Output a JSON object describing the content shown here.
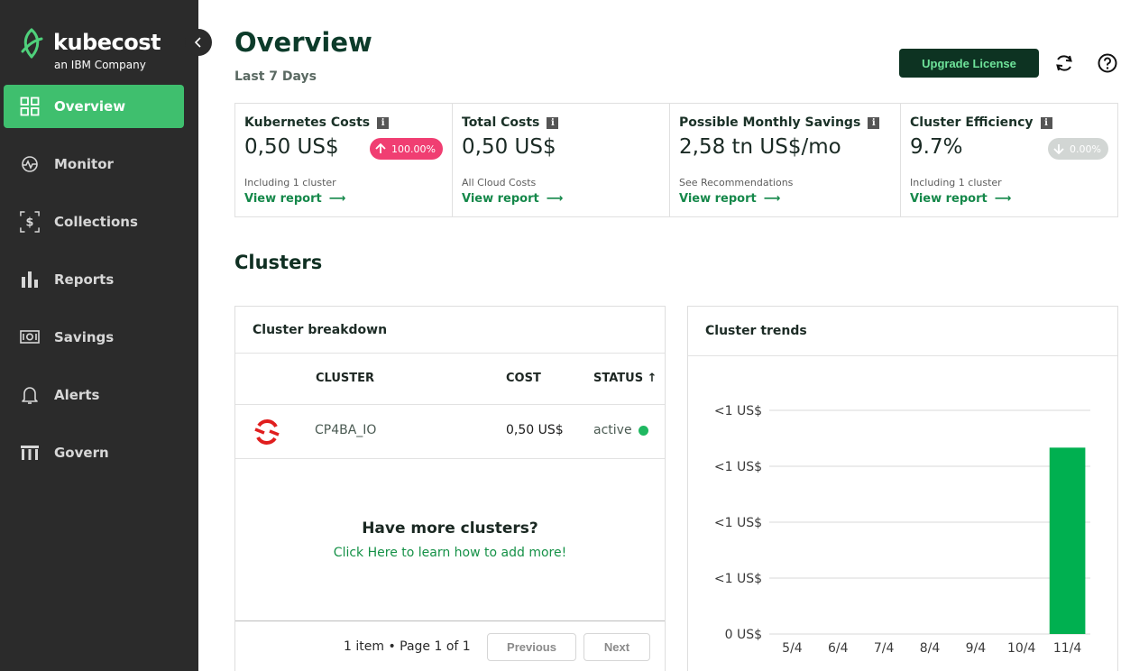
{
  "brand": {
    "name": "kubecost",
    "sub": "an IBM Company",
    "accent": "#3fbf6e"
  },
  "sidebar": {
    "items": [
      {
        "label": "Overview",
        "icon": "grid-icon",
        "active": true
      },
      {
        "label": "Monitor",
        "icon": "monitor-icon",
        "active": false
      },
      {
        "label": "Collections",
        "icon": "collections-icon",
        "active": false
      },
      {
        "label": "Reports",
        "icon": "bar-chart-icon",
        "active": false
      },
      {
        "label": "Savings",
        "icon": "savings-icon",
        "active": false
      },
      {
        "label": "Alerts",
        "icon": "bell-icon",
        "active": false
      },
      {
        "label": "Govern",
        "icon": "govern-icon",
        "active": false
      }
    ]
  },
  "header": {
    "title": "Overview",
    "subtitle": "Last 7 Days",
    "upgrade_label": "Upgrade License"
  },
  "cards": [
    {
      "title": "Kubernetes Costs",
      "value": "0,50 US$",
      "badge": "100.00%",
      "badge_dir": "up",
      "note": "Including 1 cluster",
      "link": "View report"
    },
    {
      "title": "Total Costs",
      "value": "0,50 US$",
      "note": "All Cloud Costs",
      "link": "View report"
    },
    {
      "title": "Possible Monthly Savings",
      "value": "2,58 tn US$/mo",
      "note": "See Recommendations",
      "link": "View report"
    },
    {
      "title": "Cluster Efficiency",
      "value": "9.7%",
      "badge": "0.00%",
      "badge_dir": "down",
      "note": "Including 1 cluster",
      "link": "View report"
    }
  ],
  "clusters": {
    "section_title": "Clusters",
    "breakdown": {
      "title": "Cluster breakdown",
      "columns": [
        "CLUSTER",
        "COST",
        "STATUS ↑"
      ],
      "rows": [
        {
          "cluster": "CP4BA_IO",
          "cost": "0,50 US$",
          "status": "active",
          "status_color": "#1fb861"
        }
      ],
      "more_title": "Have more clusters?",
      "more_link": "Click Here to learn how to add more!",
      "pagination": {
        "info": "1 item • Page 1 of 1",
        "prev": "Previous",
        "next": "Next"
      }
    },
    "trends": {
      "title": "Cluster trends"
    }
  },
  "chart_data": {
    "type": "bar",
    "title": "",
    "categories": [
      "5/4",
      "6/4",
      "7/4",
      "8/4",
      "9/4",
      "10/4",
      "11/4"
    ],
    "values": [
      0,
      0,
      0,
      0,
      0,
      0,
      0.5
    ],
    "ylim": [
      0,
      0.6
    ],
    "ytick_values": [
      0,
      0.15,
      0.3,
      0.45,
      0.6
    ],
    "ytick_labels": [
      "0 US$",
      "<1 US$",
      "<1 US$",
      "<1 US$",
      "<1 US$"
    ],
    "bar_color": "#00b050",
    "grid": true
  }
}
